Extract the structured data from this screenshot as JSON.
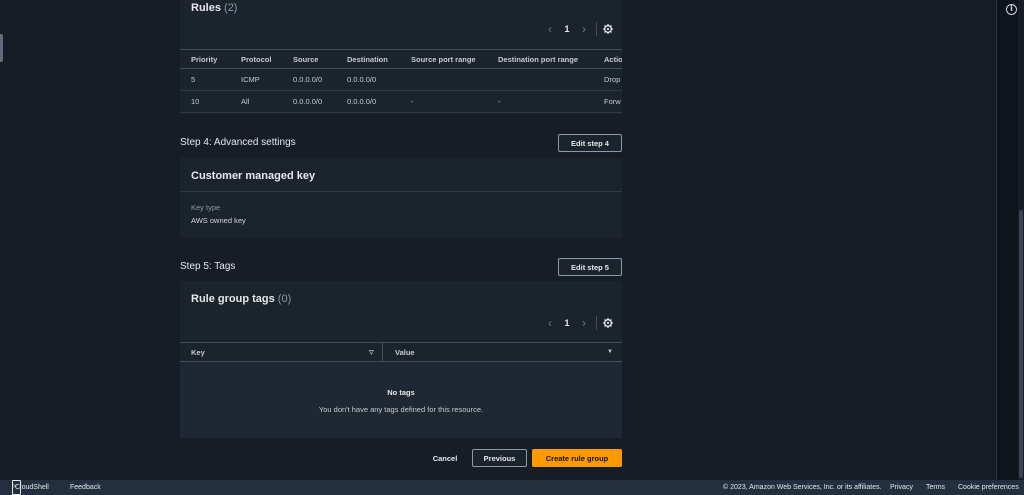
{
  "rules_panel": {
    "title": "Rules",
    "count": "(2)",
    "pager": {
      "prev": "‹",
      "page": "1",
      "next": "›"
    },
    "columns": [
      "Priority",
      "Protocol",
      "Source",
      "Destination",
      "Source port range",
      "Destination port range",
      "Actio"
    ],
    "rows": [
      [
        "5",
        "ICMP",
        "0.0.0.0/0",
        "0.0.0.0/0",
        "",
        "",
        "Drop"
      ],
      [
        "10",
        "All",
        "0.0.0.0/0",
        "0.0.0.0/0",
        "-",
        "-",
        "Forw"
      ]
    ]
  },
  "step4": {
    "title": "Step 4: Advanced settings",
    "edit_label": "Edit step 4",
    "panel_title": "Customer managed key",
    "key_type_label": "Key type",
    "key_type_value": "AWS owned key"
  },
  "step5": {
    "title": "Step 5: Tags",
    "edit_label": "Edit step 5",
    "panel_title": "Rule group tags",
    "count": "(0)",
    "pager": {
      "prev": "‹",
      "page": "1",
      "next": "›"
    },
    "columns": [
      "Key",
      "Value"
    ],
    "empty_title": "No tags",
    "empty_desc": "You don't have any tags defined for this resource."
  },
  "actions": {
    "cancel": "Cancel",
    "previous": "Previous",
    "create": "Create rule group"
  },
  "footer": {
    "cloudshell": "CloudShell",
    "feedback": "Feedback",
    "copyright": "© 2023, Amazon Web Services, Inc. or its affiliates.",
    "privacy": "Privacy",
    "terms": "Terms",
    "cookies": "Cookie preferences"
  },
  "icons": {
    "info": "info-icon",
    "settings": "gear-icon",
    "cloudshell": "terminal-icon",
    "sort": "sort-down-icon"
  },
  "colors": {
    "primary_button": "#ff9900",
    "background": "#161d26",
    "panel": "#1b232d",
    "footer": "#232f3e"
  }
}
